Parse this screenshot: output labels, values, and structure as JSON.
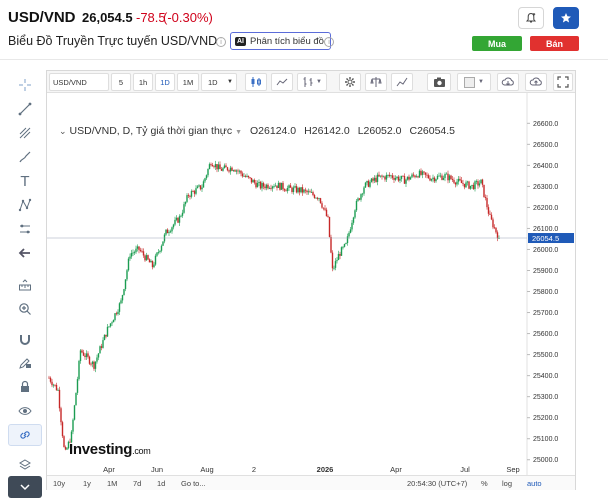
{
  "header": {
    "pair": "USD/VND",
    "price": "26,054.5",
    "change": "-78.5",
    "change_pct": "(-0.30%)",
    "subtitle": "Biểu Đồ Truyền Trực tuyến USD/VND",
    "analysis_badge": "AI",
    "analysis_label": "Phân tích biểu đồ",
    "buy_label": "Mua",
    "sell_label": "Bán"
  },
  "toolbar": {
    "symbol": "USD/VND",
    "intervals": [
      "5",
      "1h",
      "1D",
      "1M",
      "1D"
    ],
    "selected_interval": "1D"
  },
  "legend": {
    "title": "USD/VND, D, Tỷ giá thời gian thực",
    "open": "O26124.0",
    "high": "H26142.0",
    "low": "L26052.0",
    "close": "C26054.5"
  },
  "logo": {
    "name": "Investing",
    "suffix": ".com"
  },
  "bottom_bar": {
    "ranges": [
      "10y",
      "1y",
      "1M",
      "7d",
      "1d",
      "Go to..."
    ],
    "time": "20:54:30 (UTC+7)",
    "percent": "%",
    "log": "log",
    "auto": "auto"
  },
  "colors": {
    "up": "#26a69a",
    "down": "#ef5350",
    "body_up": "#1b9c51",
    "body_down": "#c62828",
    "price_tag": "#1f5ab8"
  },
  "chart_data": {
    "type": "candlestick",
    "title": "USD/VND, D, Tỷ giá thời gian thực",
    "x_labels": [
      "Apr",
      "Jun",
      "Aug",
      "2",
      "2026",
      "Apr",
      "Jul",
      "Sep"
    ],
    "x_label_bold": "2026",
    "y_ticks": [
      25000.0,
      25100.0,
      25200.0,
      25300.0,
      25400.0,
      25500.0,
      25600.0,
      25700.0,
      25800.0,
      25900.0,
      26000.0,
      26100.0,
      26200.0,
      26300.0,
      26400.0,
      26500.0,
      26600.0
    ],
    "ylim": [
      24975,
      26630
    ],
    "last_price": "26054.5",
    "series": [
      {
        "t": 0,
        "close": 25390
      },
      {
        "t": 0.02,
        "close": 25330
      },
      {
        "t": 0.035,
        "close": 25020
      },
      {
        "t": 0.05,
        "close": 25120
      },
      {
        "t": 0.07,
        "close": 25520
      },
      {
        "t": 0.1,
        "close": 25450
      },
      {
        "t": 0.13,
        "close": 25620
      },
      {
        "t": 0.16,
        "close": 25750
      },
      {
        "t": 0.18,
        "close": 25980
      },
      {
        "t": 0.2,
        "close": 26000
      },
      {
        "t": 0.23,
        "close": 25920
      },
      {
        "t": 0.26,
        "close": 26080
      },
      {
        "t": 0.29,
        "close": 26150
      },
      {
        "t": 0.31,
        "close": 26260
      },
      {
        "t": 0.34,
        "close": 26300
      },
      {
        "t": 0.36,
        "close": 26420
      },
      {
        "t": 0.38,
        "close": 26380
      },
      {
        "t": 0.41,
        "close": 26390
      },
      {
        "t": 0.44,
        "close": 26340
      },
      {
        "t": 0.47,
        "close": 26300
      },
      {
        "t": 0.5,
        "close": 26310
      },
      {
        "t": 0.53,
        "close": 26290
      },
      {
        "t": 0.56,
        "close": 26280
      },
      {
        "t": 0.6,
        "close": 26250
      },
      {
        "t": 0.62,
        "close": 26140
      },
      {
        "t": 0.63,
        "close": 25900
      },
      {
        "t": 0.645,
        "close": 25980
      },
      {
        "t": 0.66,
        "close": 26020
      },
      {
        "t": 0.68,
        "close": 26200
      },
      {
        "t": 0.7,
        "close": 26300
      },
      {
        "t": 0.73,
        "close": 26340
      },
      {
        "t": 0.76,
        "close": 26350
      },
      {
        "t": 0.79,
        "close": 26330
      },
      {
        "t": 0.82,
        "close": 26360
      },
      {
        "t": 0.85,
        "close": 26340
      },
      {
        "t": 0.88,
        "close": 26350
      },
      {
        "t": 0.91,
        "close": 26320
      },
      {
        "t": 0.94,
        "close": 26300
      },
      {
        "t": 0.96,
        "close": 26320
      },
      {
        "t": 0.98,
        "close": 26150
      },
      {
        "t": 1.0,
        "close": 26054.5
      }
    ]
  }
}
